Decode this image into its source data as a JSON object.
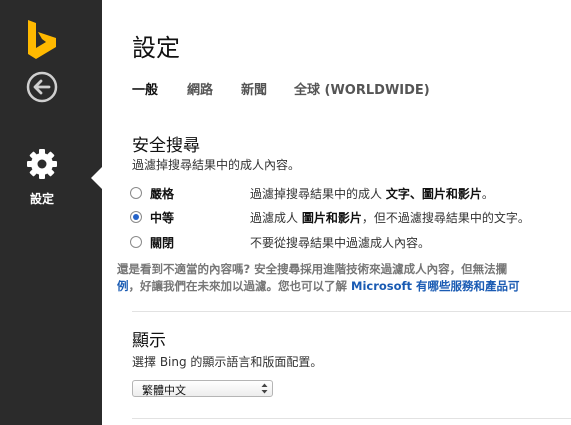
{
  "sidebar": {
    "logo": "bing-logo",
    "back_icon": "back-arrow-icon",
    "nav_item": {
      "icon": "gear-icon",
      "label": "設定"
    }
  },
  "page": {
    "title": "設定"
  },
  "tabs": [
    {
      "label": "一般",
      "active": true
    },
    {
      "label": "網路",
      "active": false
    },
    {
      "label": "新聞",
      "active": false
    },
    {
      "label": "全球 (WORLDWIDE)",
      "active": false
    }
  ],
  "safesearch": {
    "title": "安全搜尋",
    "description": "過濾掉搜尋結果中的成人內容。",
    "options": [
      {
        "label": "嚴格",
        "desc_prefix": "過濾掉搜尋結果中的成人 ",
        "desc_bold": "文字、圖片和影片",
        "desc_suffix": "。",
        "checked": false
      },
      {
        "label": "中等",
        "desc_prefix": "過濾成人 ",
        "desc_bold": "圖片和影片",
        "desc_suffix": "，但不過濾搜尋結果中的文字。",
        "checked": true
      },
      {
        "label": "關閉",
        "desc_prefix": "不要從搜尋結果中過濾成人內容。",
        "desc_bold": "",
        "desc_suffix": "",
        "checked": false
      }
    ],
    "note_line1": "還是看到不適當的內容嗎? 安全搜尋採用進階技術來過濾成人內容，但無法攔",
    "note_line2_link1": "例",
    "note_line2_text": "，好讓我們在未來加以過濾。您也可以了解 ",
    "note_line2_link2": "Microsoft 有哪些服務和產品可"
  },
  "display": {
    "title": "顯示",
    "description": "選擇 Bing 的顯示語言和版面配置。",
    "language_select": {
      "value": "繁體中文"
    }
  },
  "colors": {
    "sidebar_bg": "#2b2b2b",
    "bing_logo": "#ffb900",
    "link": "#1a5bb3",
    "radio_checked": "#2563c9"
  }
}
